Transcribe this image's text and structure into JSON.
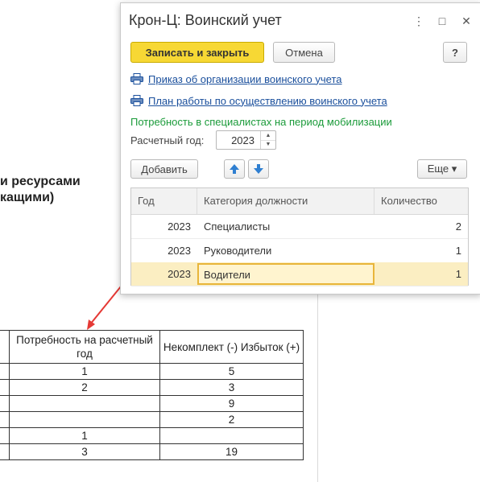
{
  "background_doc": {
    "heading_line1": "и ресурсами",
    "heading_line2": "кащими)",
    "table": {
      "headers": [
        "",
        "Потребность на расчетный год",
        "Некомплект (-) Избыток (+)"
      ],
      "rows": [
        [
          "",
          "1",
          "5"
        ],
        [
          "",
          "2",
          "3"
        ],
        [
          "",
          "",
          "9"
        ],
        [
          "",
          "",
          "2"
        ],
        [
          "",
          "1",
          ""
        ],
        [
          "",
          "3",
          "19"
        ]
      ]
    },
    "arrow_color": "#e53935"
  },
  "window": {
    "title": "Крон-Ц: Воинский учет",
    "title_buttons": {
      "more": "⋮",
      "maximize": "□",
      "close": "✕"
    },
    "toolbar": {
      "save_close_label": "Записать и закрыть",
      "cancel_label": "Отмена",
      "help_label": "?"
    },
    "links": [
      "Приказ об организации воинского учета",
      "План работы по осуществлению воинского учета"
    ],
    "section_label": "Потребность в специалистах на период мобилизации",
    "year_field": {
      "label": "Расчетный год:",
      "value": "2023"
    },
    "grid_toolbar": {
      "add_label": "Добавить",
      "more_label": "Еще ▾"
    },
    "grid": {
      "columns": [
        "Год",
        "Категория должности",
        "Количество"
      ],
      "rows": [
        {
          "year": "2023",
          "category": "Специалисты",
          "qty": "2"
        },
        {
          "year": "2023",
          "category": "Руководители",
          "qty": "1"
        },
        {
          "year": "2023",
          "category": "Водители",
          "qty": "1"
        }
      ],
      "selected_index": 2
    },
    "colors": {
      "primary_button": "#f7d834",
      "link": "#1a4f9c",
      "section_label": "#1b9b3a",
      "selected_row": "#fbeec2",
      "arrow_blue": "#2f7fd1"
    }
  }
}
